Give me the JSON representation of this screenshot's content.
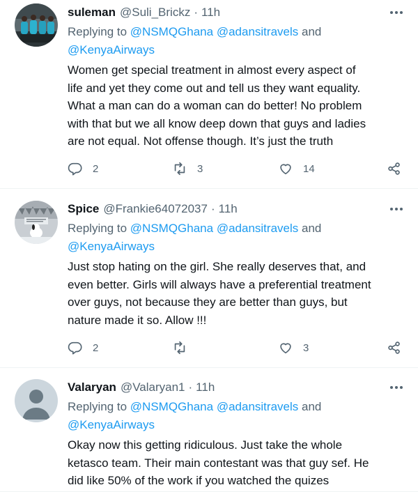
{
  "tweets": [
    {
      "name": "suleman",
      "handle": "@Suli_Brickz",
      "dot": "·",
      "time": "11h",
      "replying_prefix": "Replying to ",
      "mention1": "@NSMQGhana",
      "mention2": "@adansitravels",
      "and": " and",
      "mention3": "@KenyaAirways",
      "text_lines": [
        "Women get special treatment in almost every aspect of",
        "life and yet they come out and tell us they want equality.",
        "What a man can do a woman can do better! No problem",
        "with that but we all know deep down that guys and ladies",
        "are not equal. Not offense though. It’s just the truth"
      ],
      "replies": "2",
      "retweets": "3",
      "likes": "14",
      "avatar": "team-photo"
    },
    {
      "name": "Spice",
      "handle": "@Frankie64072037",
      "dot": "·",
      "time": "11h",
      "replying_prefix": "Replying to ",
      "mention1": "@NSMQGhana",
      "mention2": "@adansitravels",
      "and": " and",
      "mention3": "@KenyaAirways",
      "text_lines": [
        "Just stop hating on the girl. She really deserves that, and",
        "even better. Girls will always have a preferential treatment",
        "over guys, not because they are better than guys, but",
        "nature made it so. Allow !!!"
      ],
      "replies": "2",
      "retweets": "",
      "likes": "3",
      "avatar": "snoopy-winter"
    },
    {
      "name": "Valaryan",
      "handle": "@Valaryan1",
      "dot": "·",
      "time": "11h",
      "replying_prefix": "Replying to ",
      "mention1": "@NSMQGhana",
      "mention2": "@adansitravels",
      "and": " and",
      "mention3": "@KenyaAirways",
      "text_lines": [
        "Okay now this getting ridiculous. Just take the whole",
        "ketasco team. Their main contestant was that guy sef. He",
        "did like 50% of the work if you watched the quizes"
      ],
      "avatar": "default-avatar"
    }
  ],
  "colors": {
    "accent": "#1d9bf0",
    "muted": "#536471",
    "text": "#0f1419",
    "border": "#eff3f4"
  }
}
